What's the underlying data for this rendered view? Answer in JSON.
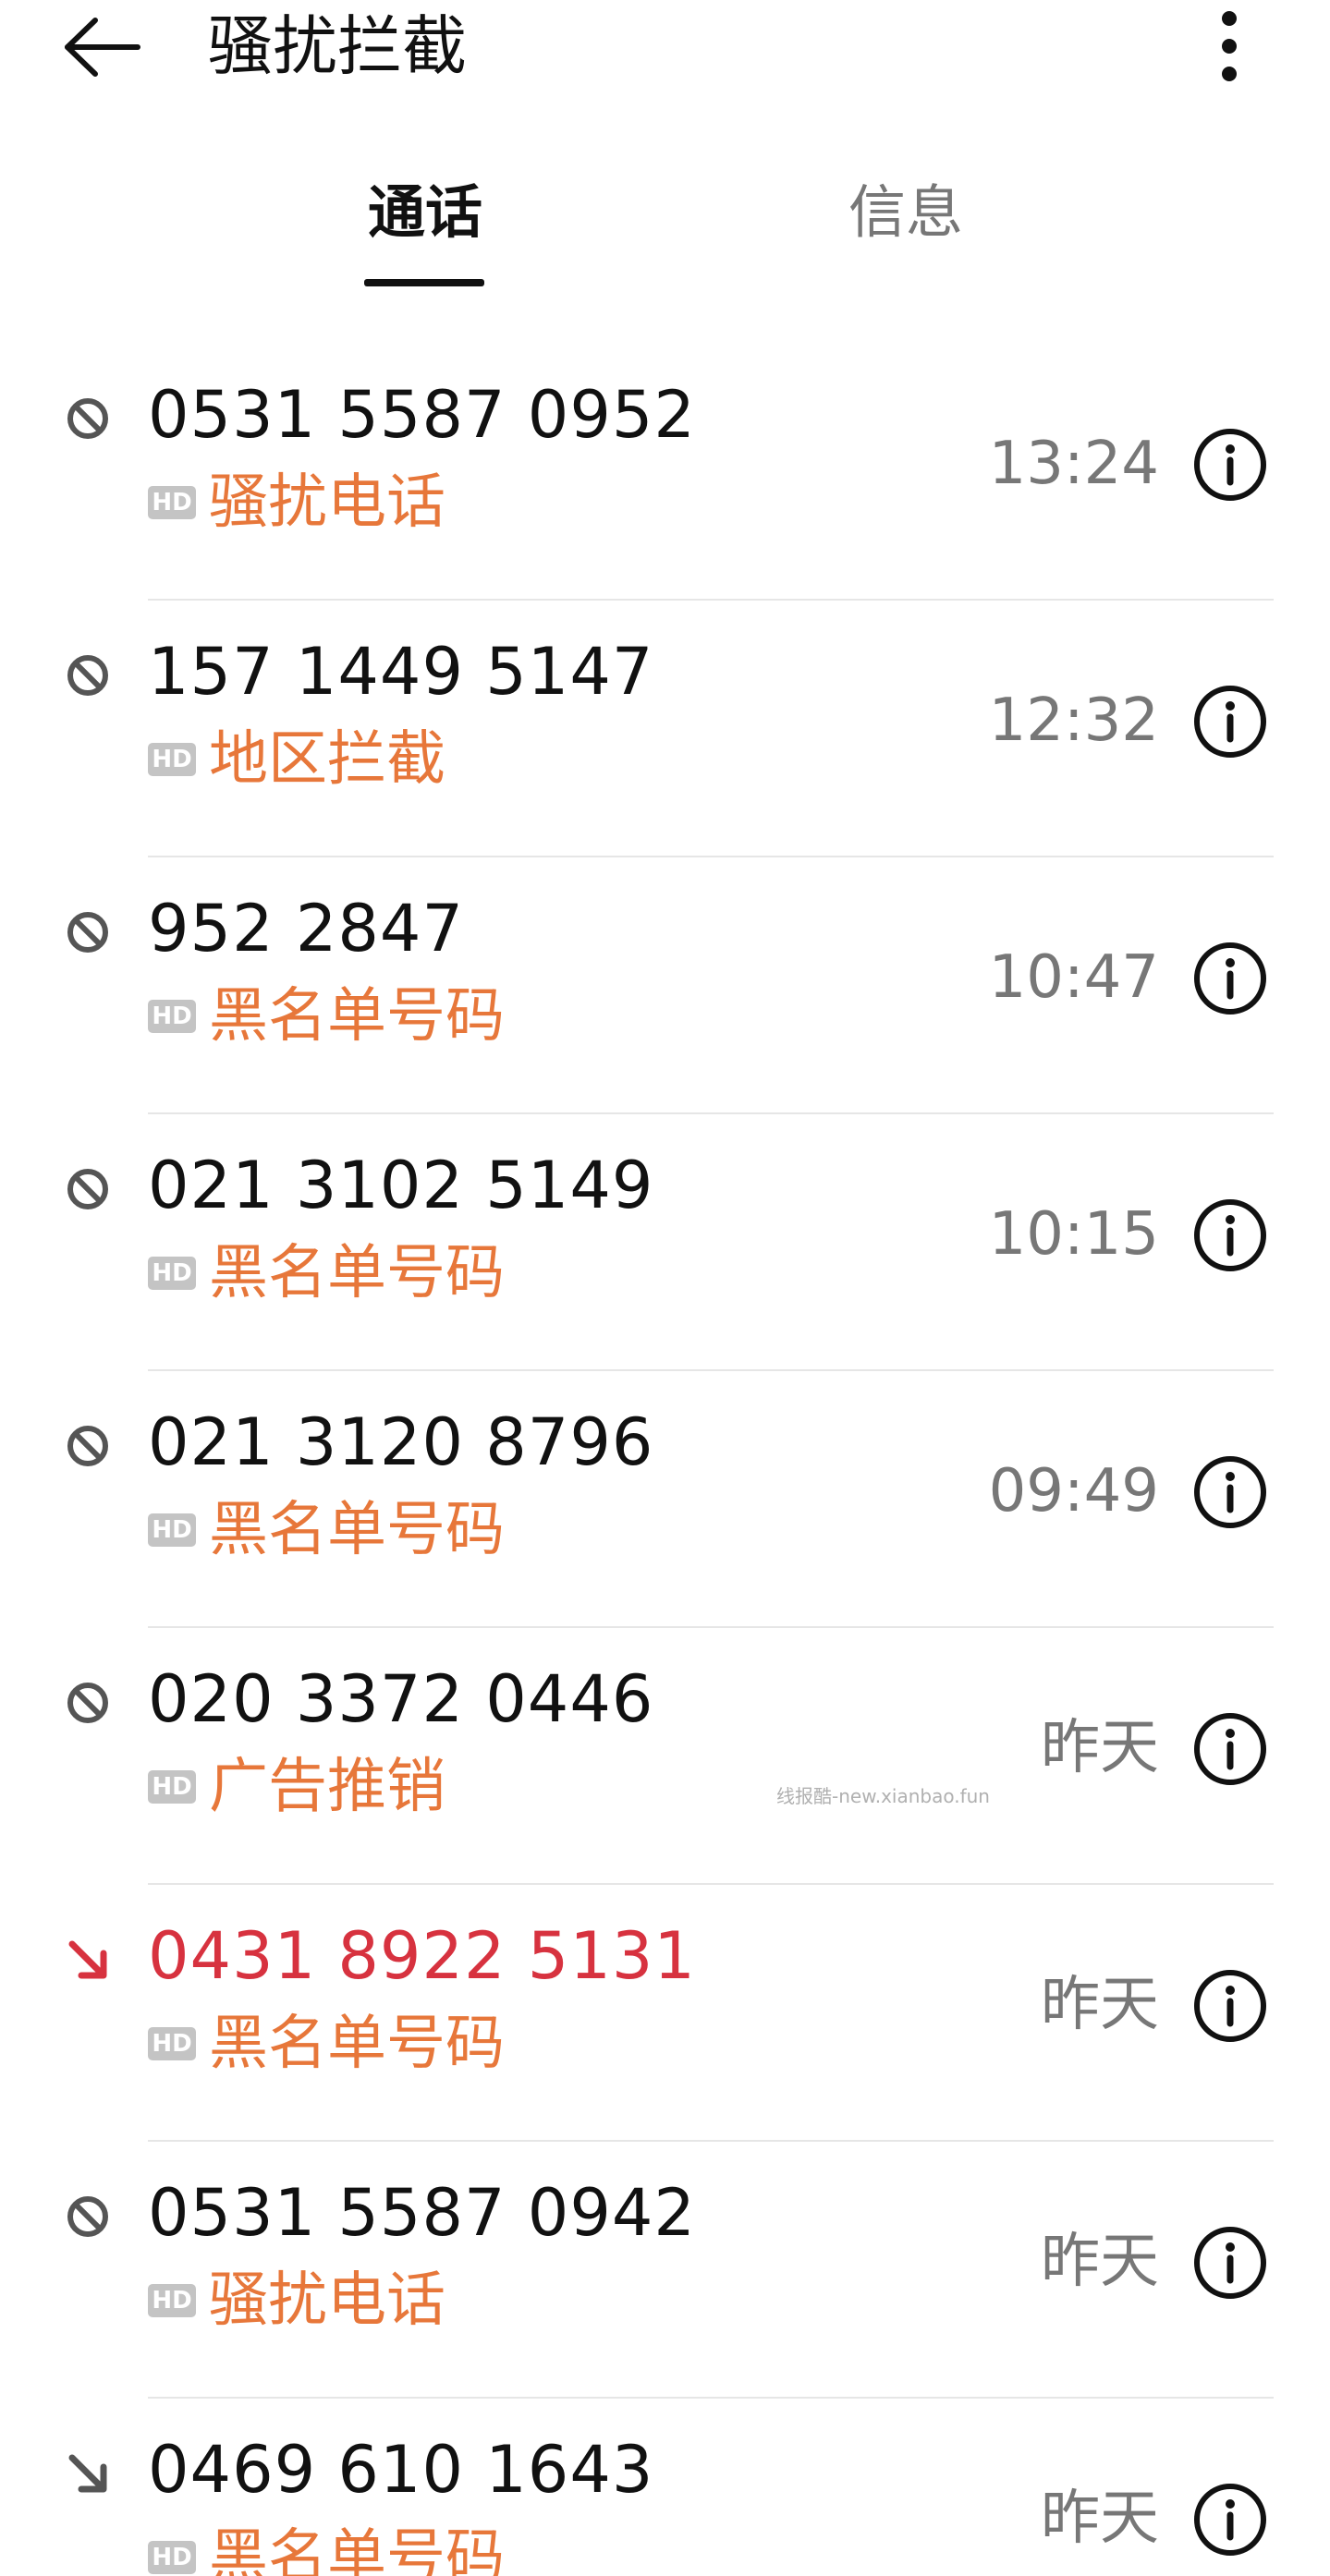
{
  "header": {
    "title": "骚扰拦截",
    "back_icon": "back-arrow-icon",
    "more_icon": "more-vertical-icon"
  },
  "tabs": [
    {
      "label": "通话",
      "active": true
    },
    {
      "label": "信息",
      "active": false
    }
  ],
  "calls": [
    {
      "number": "0531 5587 0952",
      "tag": "骚扰电话",
      "time": "13:24",
      "icon": "blocked-icon",
      "missed": false
    },
    {
      "number": "157 1449 5147",
      "tag": "地区拦截",
      "time": "12:32",
      "icon": "blocked-icon",
      "missed": false
    },
    {
      "number": "952 2847",
      "tag": "黑名单号码",
      "time": "10:47",
      "icon": "blocked-icon",
      "missed": false
    },
    {
      "number": "021 3102 5149",
      "tag": "黑名单号码",
      "time": "10:15",
      "icon": "blocked-icon",
      "missed": false
    },
    {
      "number": "021 3120 8796",
      "tag": "黑名单号码",
      "time": "09:49",
      "icon": "blocked-icon",
      "missed": false
    },
    {
      "number": "020 3372 0446",
      "tag": "广告推销",
      "time": "昨天",
      "icon": "blocked-icon",
      "missed": false
    },
    {
      "number": "0431 8922 5131",
      "tag": "黑名单号码",
      "time": "昨天",
      "icon": "missed-call-icon",
      "missed": true
    },
    {
      "number": "0531 5587 0942",
      "tag": "骚扰电话",
      "time": "昨天",
      "icon": "blocked-icon",
      "missed": false
    },
    {
      "number": "0469 610 1643",
      "tag": "黑名单号码",
      "time": "昨天",
      "icon": "incoming-call-icon",
      "missed": false
    }
  ],
  "hd_label": "HD",
  "watermark": "线报酷-new.xianbao.fun",
  "colors": {
    "tag": "#e7773a",
    "missed": "#d7323f",
    "text": "#111111",
    "secondary": "#777777"
  }
}
